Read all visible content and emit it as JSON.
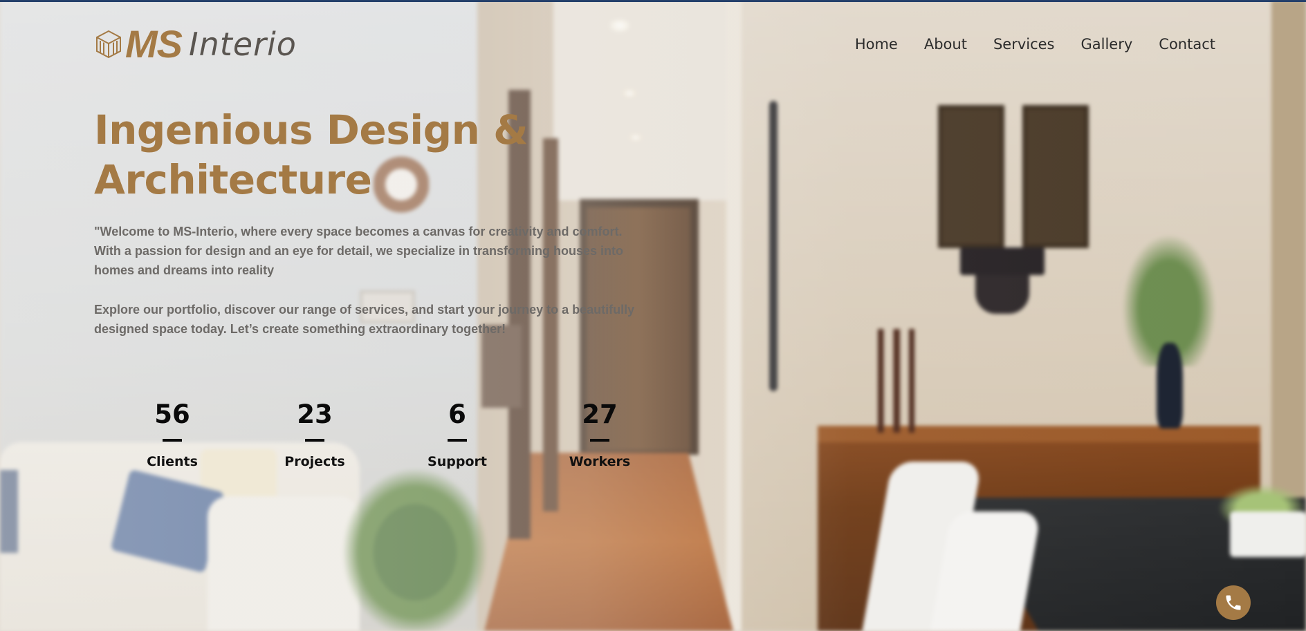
{
  "brand": {
    "ms": "MS",
    "interio": "Interio",
    "accent": "#a47a45"
  },
  "nav": {
    "items": [
      {
        "label": "Home"
      },
      {
        "label": "About"
      },
      {
        "label": "Services"
      },
      {
        "label": "Gallery"
      },
      {
        "label": "Contact"
      }
    ]
  },
  "hero": {
    "title_line1": "Ingenious Design &",
    "title_line2": "Architecture",
    "paragraph1": "\"Welcome to MS-Interio, where every space becomes a canvas for creativity and comfort. With a passion for design and an eye for detail, we specialize in transforming houses into homes and dreams into reality",
    "paragraph2": "Explore our portfolio, discover our range of services, and start your journey to a beautifully designed space today. Let’s create something extraordinary together!"
  },
  "stats": [
    {
      "value": "56",
      "label": "Clients"
    },
    {
      "value": "23",
      "label": "Projects"
    },
    {
      "value": "6",
      "label": "Support"
    },
    {
      "value": "27",
      "label": "Workers"
    }
  ],
  "call_button": {
    "icon": "phone-icon",
    "color": "#a47a45"
  }
}
